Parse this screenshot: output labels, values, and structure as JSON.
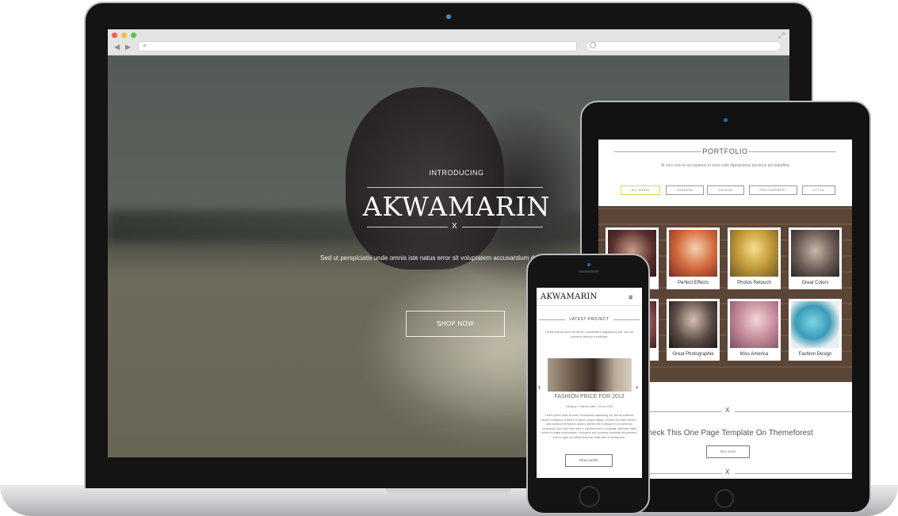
{
  "colors": {
    "hero_overlay": "#5a5a55",
    "laptop_silver": "#c9cbce",
    "device_black": "#141414",
    "filter_active": "#d8d84a",
    "card_text": "#333333"
  },
  "icons": {
    "browser_back": "◀",
    "browser_forward": "▶",
    "url_add": "+",
    "fullscreen": "⤢",
    "phone_menu": "≡",
    "phone_prev": "‹",
    "phone_next": "›",
    "close_mark": "X"
  },
  "hero": {
    "introducing": "INTRODUCING",
    "brand": "AKWAMARIN",
    "brand_mark": "X",
    "description": "Sed ut perspiciatis unde omnis iste natus error sit voluptatem accusantium doloremque eaque ipsa quae ab illo inventore veritatis et quasi architecto",
    "shop_button": "SHOP NOW"
  },
  "tablet": {
    "portfolio_title": "PORTFOLIO",
    "portfolio_sub": "At vero eos et accusamus et iusto odio dignissimos ducimus qui blanditiis",
    "filters": [
      "ALL WORK",
      "FASHION",
      "DESIGN",
      "PHOTOGRAPHY",
      "STYLE"
    ],
    "cards": [
      {
        "label": ""
      },
      {
        "label": "Perfect Effects"
      },
      {
        "label": "Photos Retouch"
      },
      {
        "label": "Great Colors"
      },
      {
        "label": ""
      },
      {
        "label": "Great Photographie"
      },
      {
        "label": "Miss America"
      },
      {
        "label": "Fashion Design"
      }
    ],
    "themeforest_text": "Check This One Page Template On Themeforest",
    "buy_button": "BUY NOW",
    "sep_mark": "X"
  },
  "phone": {
    "logo": "AKWAMARIN",
    "latest_title": "LATEST PROJECT",
    "latest_desc": "Lorem ipsum dolor sit amet, consectetur adipisicing elit, sed do eiusmod tempor incididunt.",
    "project_title": "FASHION PRICE FOR 2013",
    "project_meta": "Category : Fashion      Date : 24 nov 2014",
    "project_body": "Lorem ipsum dolor sit amet, consectetur adipisicing elit, sed do eiusmod tempor incididunt ut labore et dolore magna aliqua. Ut enim ad minim veniam, quis nostrud exercitation ullamco laboris nisi ut aliquip ex ea commodo consequat. Duis aute irure dolor in reprehenderit in voluptate velit esse cillum dolore eu fugiat nulla pariatur. Excepteur sint occaecat cupidatat non proident, sunt in culpa qui officia deserunt mollit anim id est laborum.",
    "read_button": "READ MORE"
  }
}
